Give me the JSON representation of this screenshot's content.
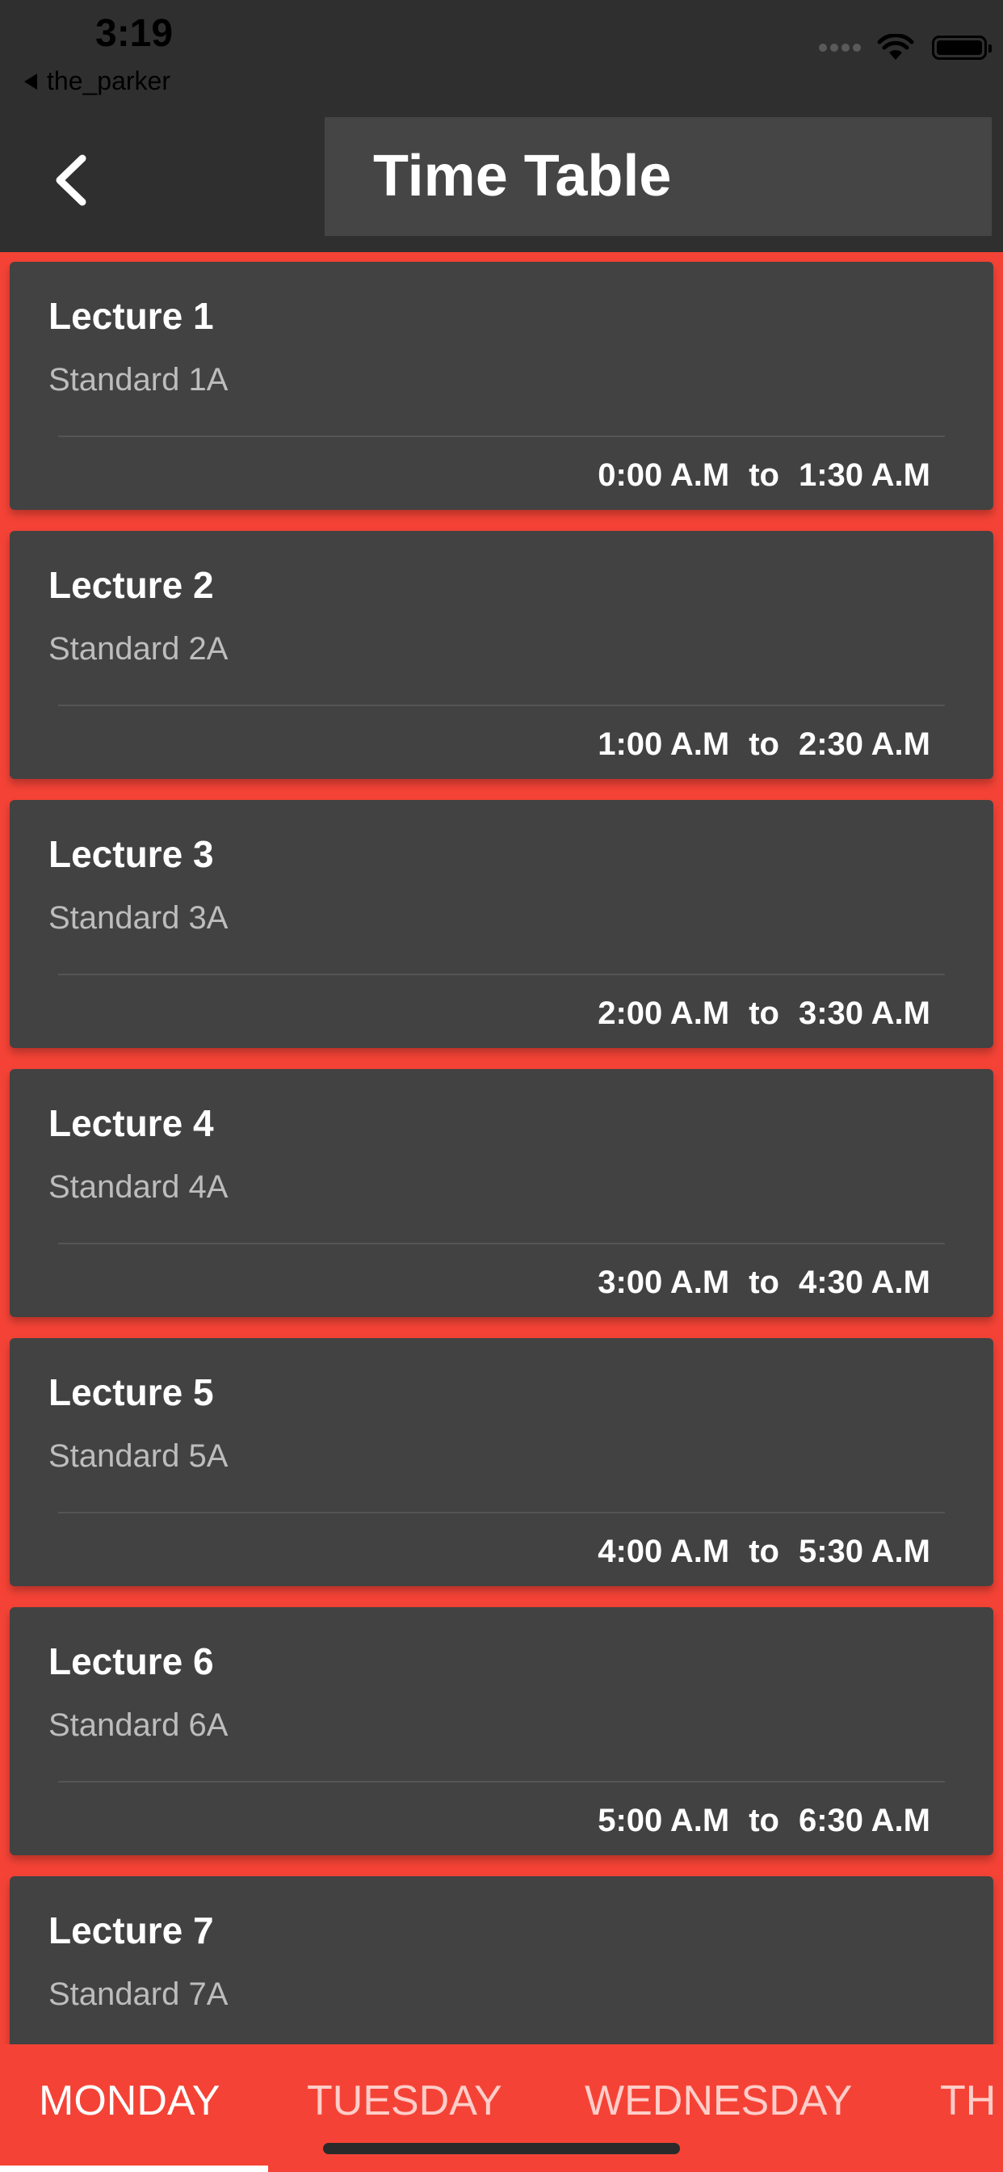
{
  "status_bar": {
    "time": "3:19",
    "back_app": "the_parker"
  },
  "header": {
    "title": "Time Table"
  },
  "lectures": [
    {
      "title": "Lecture 1",
      "subtitle": "Standard 1A",
      "start": "0:00 A.M",
      "separator": "to",
      "end": "1:30 A.M"
    },
    {
      "title": "Lecture 2",
      "subtitle": "Standard 2A",
      "start": "1:00 A.M",
      "separator": "to",
      "end": "2:30 A.M"
    },
    {
      "title": "Lecture 3",
      "subtitle": "Standard 3A",
      "start": "2:00 A.M",
      "separator": "to",
      "end": "3:30 A.M"
    },
    {
      "title": "Lecture 4",
      "subtitle": "Standard 4A",
      "start": "3:00 A.M",
      "separator": "to",
      "end": "4:30 A.M"
    },
    {
      "title": "Lecture 5",
      "subtitle": "Standard 5A",
      "start": "4:00 A.M",
      "separator": "to",
      "end": "5:30 A.M"
    },
    {
      "title": "Lecture 6",
      "subtitle": "Standard 6A",
      "start": "5:00 A.M",
      "separator": "to",
      "end": "6:30 A.M"
    },
    {
      "title": "Lecture 7",
      "subtitle": "Standard 7A",
      "start": "",
      "separator": "",
      "end": ""
    }
  ],
  "tabs": [
    {
      "label": "MONDAY"
    },
    {
      "label": "TUESDAY"
    },
    {
      "label": "WEDNESDAY"
    },
    {
      "label": "TH"
    }
  ],
  "colors": {
    "accent": "#f44336",
    "card": "#424242",
    "header": "#2f2f2f"
  },
  "icons": {
    "back": "chevron-left-icon",
    "status_back": "triangle-left-icon",
    "wifi": "wifi-icon",
    "battery": "battery-icon"
  }
}
